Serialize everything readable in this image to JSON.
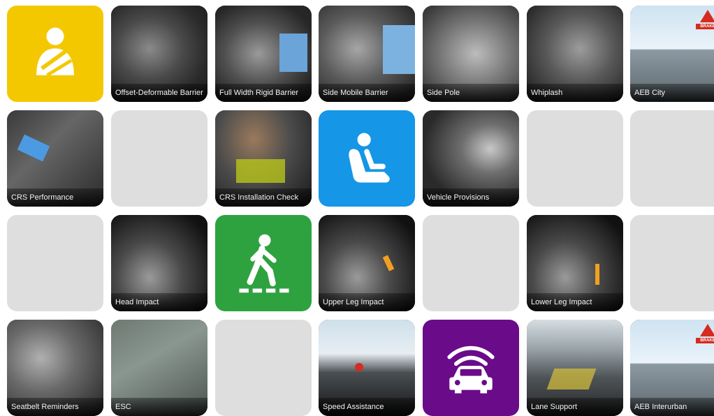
{
  "colors": {
    "adult_occupant": "#f4c800",
    "child_occupant": "#1596e6",
    "pedestrian": "#2ea23f",
    "safety_assist": "#6a0b8a",
    "empty_tile": "#dedede"
  },
  "rows": [
    [
      {
        "kind": "icon",
        "icon": "seatbelt-adult-icon",
        "color": "yellow"
      },
      {
        "kind": "photo",
        "label": "Offset-Deformable Barrier"
      },
      {
        "kind": "photo",
        "label": "Full Width Rigid Barrier"
      },
      {
        "kind": "photo",
        "label": "Side Mobile Barrier"
      },
      {
        "kind": "photo",
        "label": "Side Pole"
      },
      {
        "kind": "photo",
        "label": "Whiplash"
      },
      {
        "kind": "photo",
        "label": "AEB City",
        "badge": "BRAKE"
      }
    ],
    [
      {
        "kind": "photo",
        "label": "CRS Performance"
      },
      {
        "kind": "empty"
      },
      {
        "kind": "photo",
        "label": "CRS Installation Check"
      },
      {
        "kind": "icon",
        "icon": "child-seat-icon",
        "color": "blue"
      },
      {
        "kind": "photo",
        "label": "Vehicle Provisions"
      },
      {
        "kind": "empty"
      },
      {
        "kind": "empty"
      }
    ],
    [
      {
        "kind": "empty"
      },
      {
        "kind": "photo",
        "label": "Head Impact"
      },
      {
        "kind": "icon",
        "icon": "pedestrian-icon",
        "color": "green"
      },
      {
        "kind": "photo",
        "label": "Upper Leg Impact"
      },
      {
        "kind": "empty"
      },
      {
        "kind": "photo",
        "label": "Lower Leg Impact"
      },
      {
        "kind": "empty"
      }
    ],
    [
      {
        "kind": "photo",
        "label": "Seatbelt Reminders"
      },
      {
        "kind": "photo",
        "label": "ESC"
      },
      {
        "kind": "empty"
      },
      {
        "kind": "photo",
        "label": "Speed Assistance"
      },
      {
        "kind": "icon",
        "icon": "car-sensor-icon",
        "color": "purple"
      },
      {
        "kind": "photo",
        "label": "Lane Support"
      },
      {
        "kind": "photo",
        "label": "AEB Interurban",
        "badge": "BRAKE"
      }
    ]
  ]
}
